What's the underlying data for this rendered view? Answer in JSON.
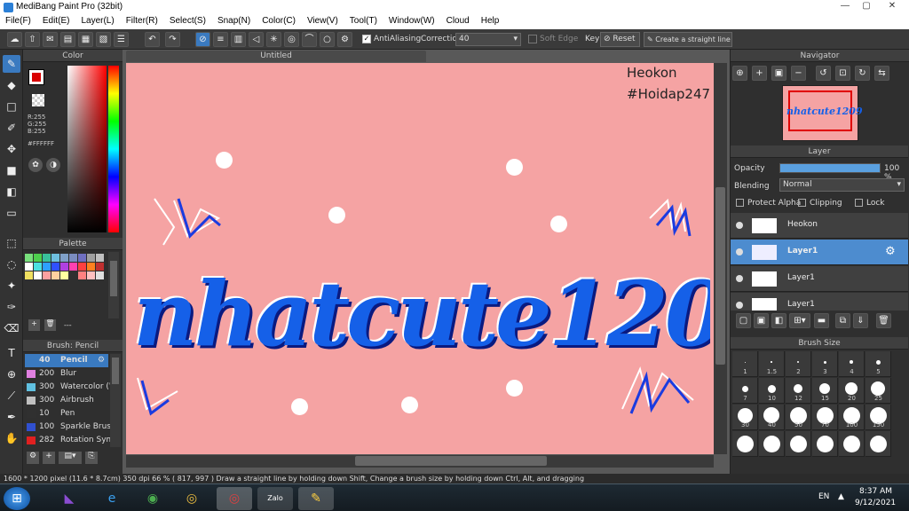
{
  "window": {
    "title": "MediBang Paint Pro (32bit)",
    "min": "—",
    "max": "▢",
    "close": "✕"
  },
  "menu": [
    "File(F)",
    "Edit(E)",
    "Layer(L)",
    "Filter(R)",
    "Select(S)",
    "Snap(N)",
    "Color(C)",
    "View(V)",
    "Tool(T)",
    "Window(W)",
    "Cloud",
    "Help"
  ],
  "toolbar": {
    "antialiasing": "AntiAliasing",
    "correction_label": "Correction",
    "correction_value": "40",
    "soft_edge": "Soft Edge",
    "key_label": "Key",
    "reset": "Reset",
    "straight_line": "Create a straight line"
  },
  "color": {
    "title": "Color",
    "r": "R:255",
    "g": "G:255",
    "b": "B:255",
    "hex": "#FFFFFF",
    "primary": "#d90000"
  },
  "palette": {
    "title": "Palette",
    "colors": [
      "#78e07c",
      "#4dd04d",
      "#39c09a",
      "#6ec0e0",
      "#7fa0c8",
      "#7a8cc0",
      "#6f6fc0",
      "#a0a0a0",
      "#c0c0c0",
      "#ffffff",
      "#4be0e0",
      "#2ea0ff",
      "#3050ff",
      "#b040e0",
      "#ff40b0",
      "#ff4040",
      "#ff8020",
      "#c03030",
      "#f0e060",
      "#ffffff",
      "#ffa0a0",
      "#ffd0a0",
      "#ffffa0",
      "#303030",
      "#ff8080",
      "#ffc0c0",
      "#e0e0e0"
    ],
    "more": "---"
  },
  "brush": {
    "title": "Brush: Pencil",
    "items": [
      {
        "size": "40",
        "name": "Pencil",
        "color": "#3a7ac0"
      },
      {
        "size": "200",
        "name": "Blur",
        "color": "#e080e0"
      },
      {
        "size": "300",
        "name": "Watercolor (W",
        "color": "#60c0e0"
      },
      {
        "size": "300",
        "name": "Airbrush",
        "color": "#c0c0c0"
      },
      {
        "size": "10",
        "name": "Pen",
        "color": "#303030"
      },
      {
        "size": "100",
        "name": "Sparkle Brush",
        "color": "#3050d0"
      },
      {
        "size": "282",
        "name": "Rotation Sym",
        "color": "#e02020"
      }
    ]
  },
  "document": {
    "tab": "Untitled",
    "watermark1": "Heokon",
    "watermark2": "#Hoidap247",
    "art_text": "nhatcute1209",
    "background": "#f5a3a3"
  },
  "navigator": {
    "title": "Navigator",
    "preview_text": "nhatcute1209"
  },
  "layer": {
    "title": "Layer",
    "opacity_label": "Opacity",
    "opacity_value": "100 %",
    "opacity": 1.0,
    "blending_label": "Blending",
    "blending_value": "Normal",
    "protect_alpha": "Protect Alpha",
    "clipping": "Clipping",
    "lock": "Lock",
    "layers": [
      {
        "name": "Heokon",
        "selected": false
      },
      {
        "name": "Layer1",
        "selected": true
      },
      {
        "name": "Layer1",
        "selected": false
      },
      {
        "name": "Layer1",
        "selected": false
      }
    ]
  },
  "brush_size": {
    "title": "Brush Size",
    "sizes": [
      "1",
      "1.5",
      "2",
      "3",
      "4",
      "5",
      "7",
      "10",
      "12",
      "15",
      "20",
      "25",
      "30",
      "40",
      "50",
      "70",
      "100",
      "150",
      "",
      "",
      "",
      "",
      "",
      ""
    ]
  },
  "status": {
    "text": "1600 * 1200 pixel   (11.6 * 8.7cm)   350 dpi   66 %   ( 817, 997 )   Draw a straight line by holding down Shift, Change a brush size by holding down Ctrl, Alt, and dragging"
  },
  "taskbar": {
    "lang": "EN",
    "time": "8:37 AM",
    "date": "9/12/2021"
  }
}
